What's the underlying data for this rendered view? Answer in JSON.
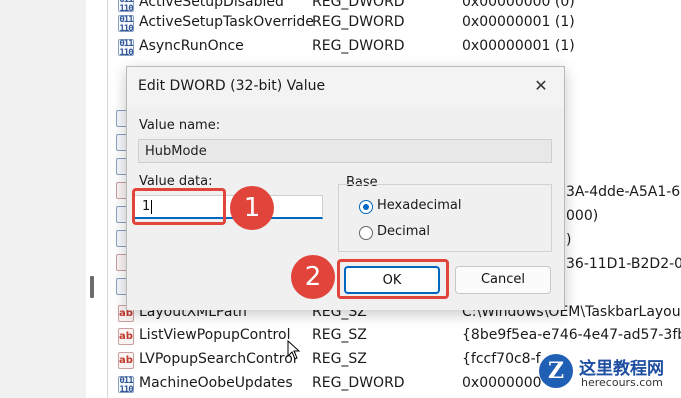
{
  "registry_rows_top": [
    {
      "name": "ActiveSetupDisabled",
      "type": "REG_DWORD",
      "value": "0x00000000 (0)",
      "icon": "dword"
    },
    {
      "name": "ActiveSetupTaskOverride",
      "type": "REG_DWORD",
      "value": "0x00000001 (1)",
      "icon": "dword"
    },
    {
      "name": "AsyncRunOnce",
      "type": "REG_DWORD",
      "value": "0x00000001 (1)",
      "icon": "dword"
    }
  ],
  "registry_partial_values": [
    "3A-4dde-A5A1-60",
    "000)",
    ")",
    "36-11D1-B2D2-00"
  ],
  "registry_rows_bottom": [
    {
      "name": "LayoutXMLPath",
      "type": "REG_SZ",
      "value": "C:\\Windows\\OEM\\TaskbarLayout",
      "icon": "sz"
    },
    {
      "name": "ListViewPopupControl",
      "type": "REG_SZ",
      "value": "{8be9f5ea-e746-4e47-ad57-3fb1",
      "icon": "sz"
    },
    {
      "name": "LVPopupSearchControl",
      "type": "REG_SZ",
      "value": "{fccf70c8-f",
      "icon": "sz"
    },
    {
      "name": "MachineOobeUpdates",
      "type": "REG_DWORD",
      "value": "0x0000000",
      "icon": "dword"
    }
  ],
  "icon_text": {
    "dword": "011\n110",
    "sz": "ab"
  },
  "dialog": {
    "title": "Edit DWORD (32-bit) Value",
    "close_glyph": "✕",
    "value_name_label": "Value name:",
    "value_name": "HubMode",
    "value_data_label": "Value data:",
    "value_data": "1",
    "base_label": "Base",
    "radio_hex": "Hexadecimal",
    "radio_dec": "Decimal",
    "selected_base": "Hexadecimal",
    "ok_label": "OK",
    "cancel_label": "Cancel"
  },
  "annotations": {
    "step1": "1",
    "step2": "2",
    "color": "#e0443b"
  },
  "watermark": {
    "logo": "Z",
    "line1": "这里教程网",
    "line2": "herecours.com"
  }
}
